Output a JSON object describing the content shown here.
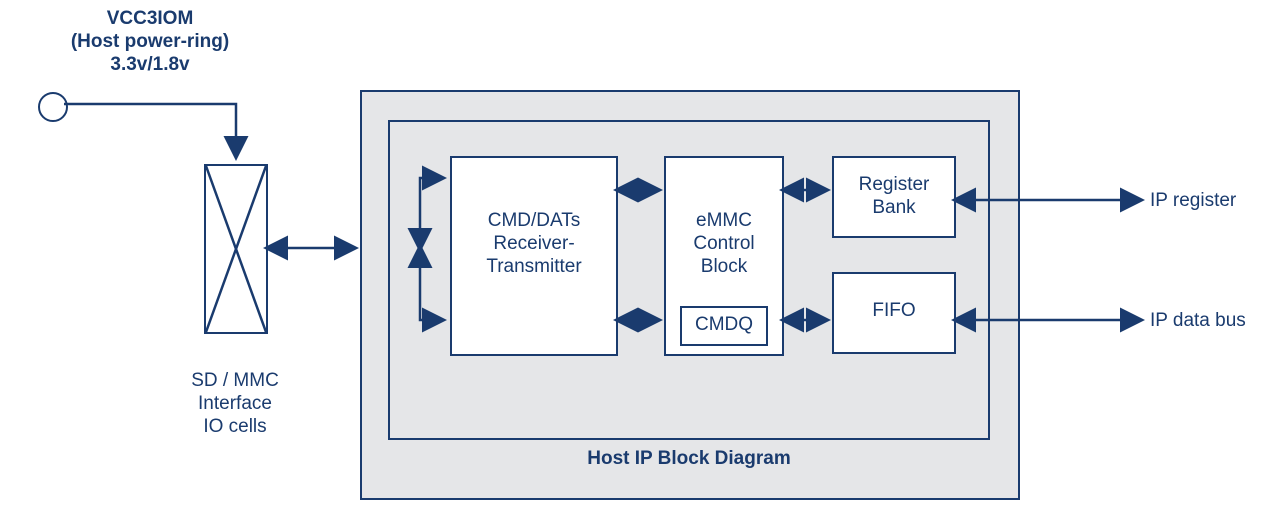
{
  "power": {
    "line1": "VCC3IOM",
    "line2": "(Host power-ring)",
    "line3": "3.3v/1.8v"
  },
  "io_cells": {
    "line1": "SD / MMC",
    "line2": "Interface",
    "line3": "IO cells"
  },
  "blocks": {
    "cmd_dats": "CMD/DATs\nReceiver-\nTransmitter",
    "emmc": "eMMC\nControl\nBlock",
    "cmdq": "CMDQ",
    "reg_bank": "Register\nBank",
    "fifo": "FIFO"
  },
  "caption": "Host IP Block Diagram",
  "outputs": {
    "register": "IP register",
    "data_bus": "IP data bus"
  }
}
